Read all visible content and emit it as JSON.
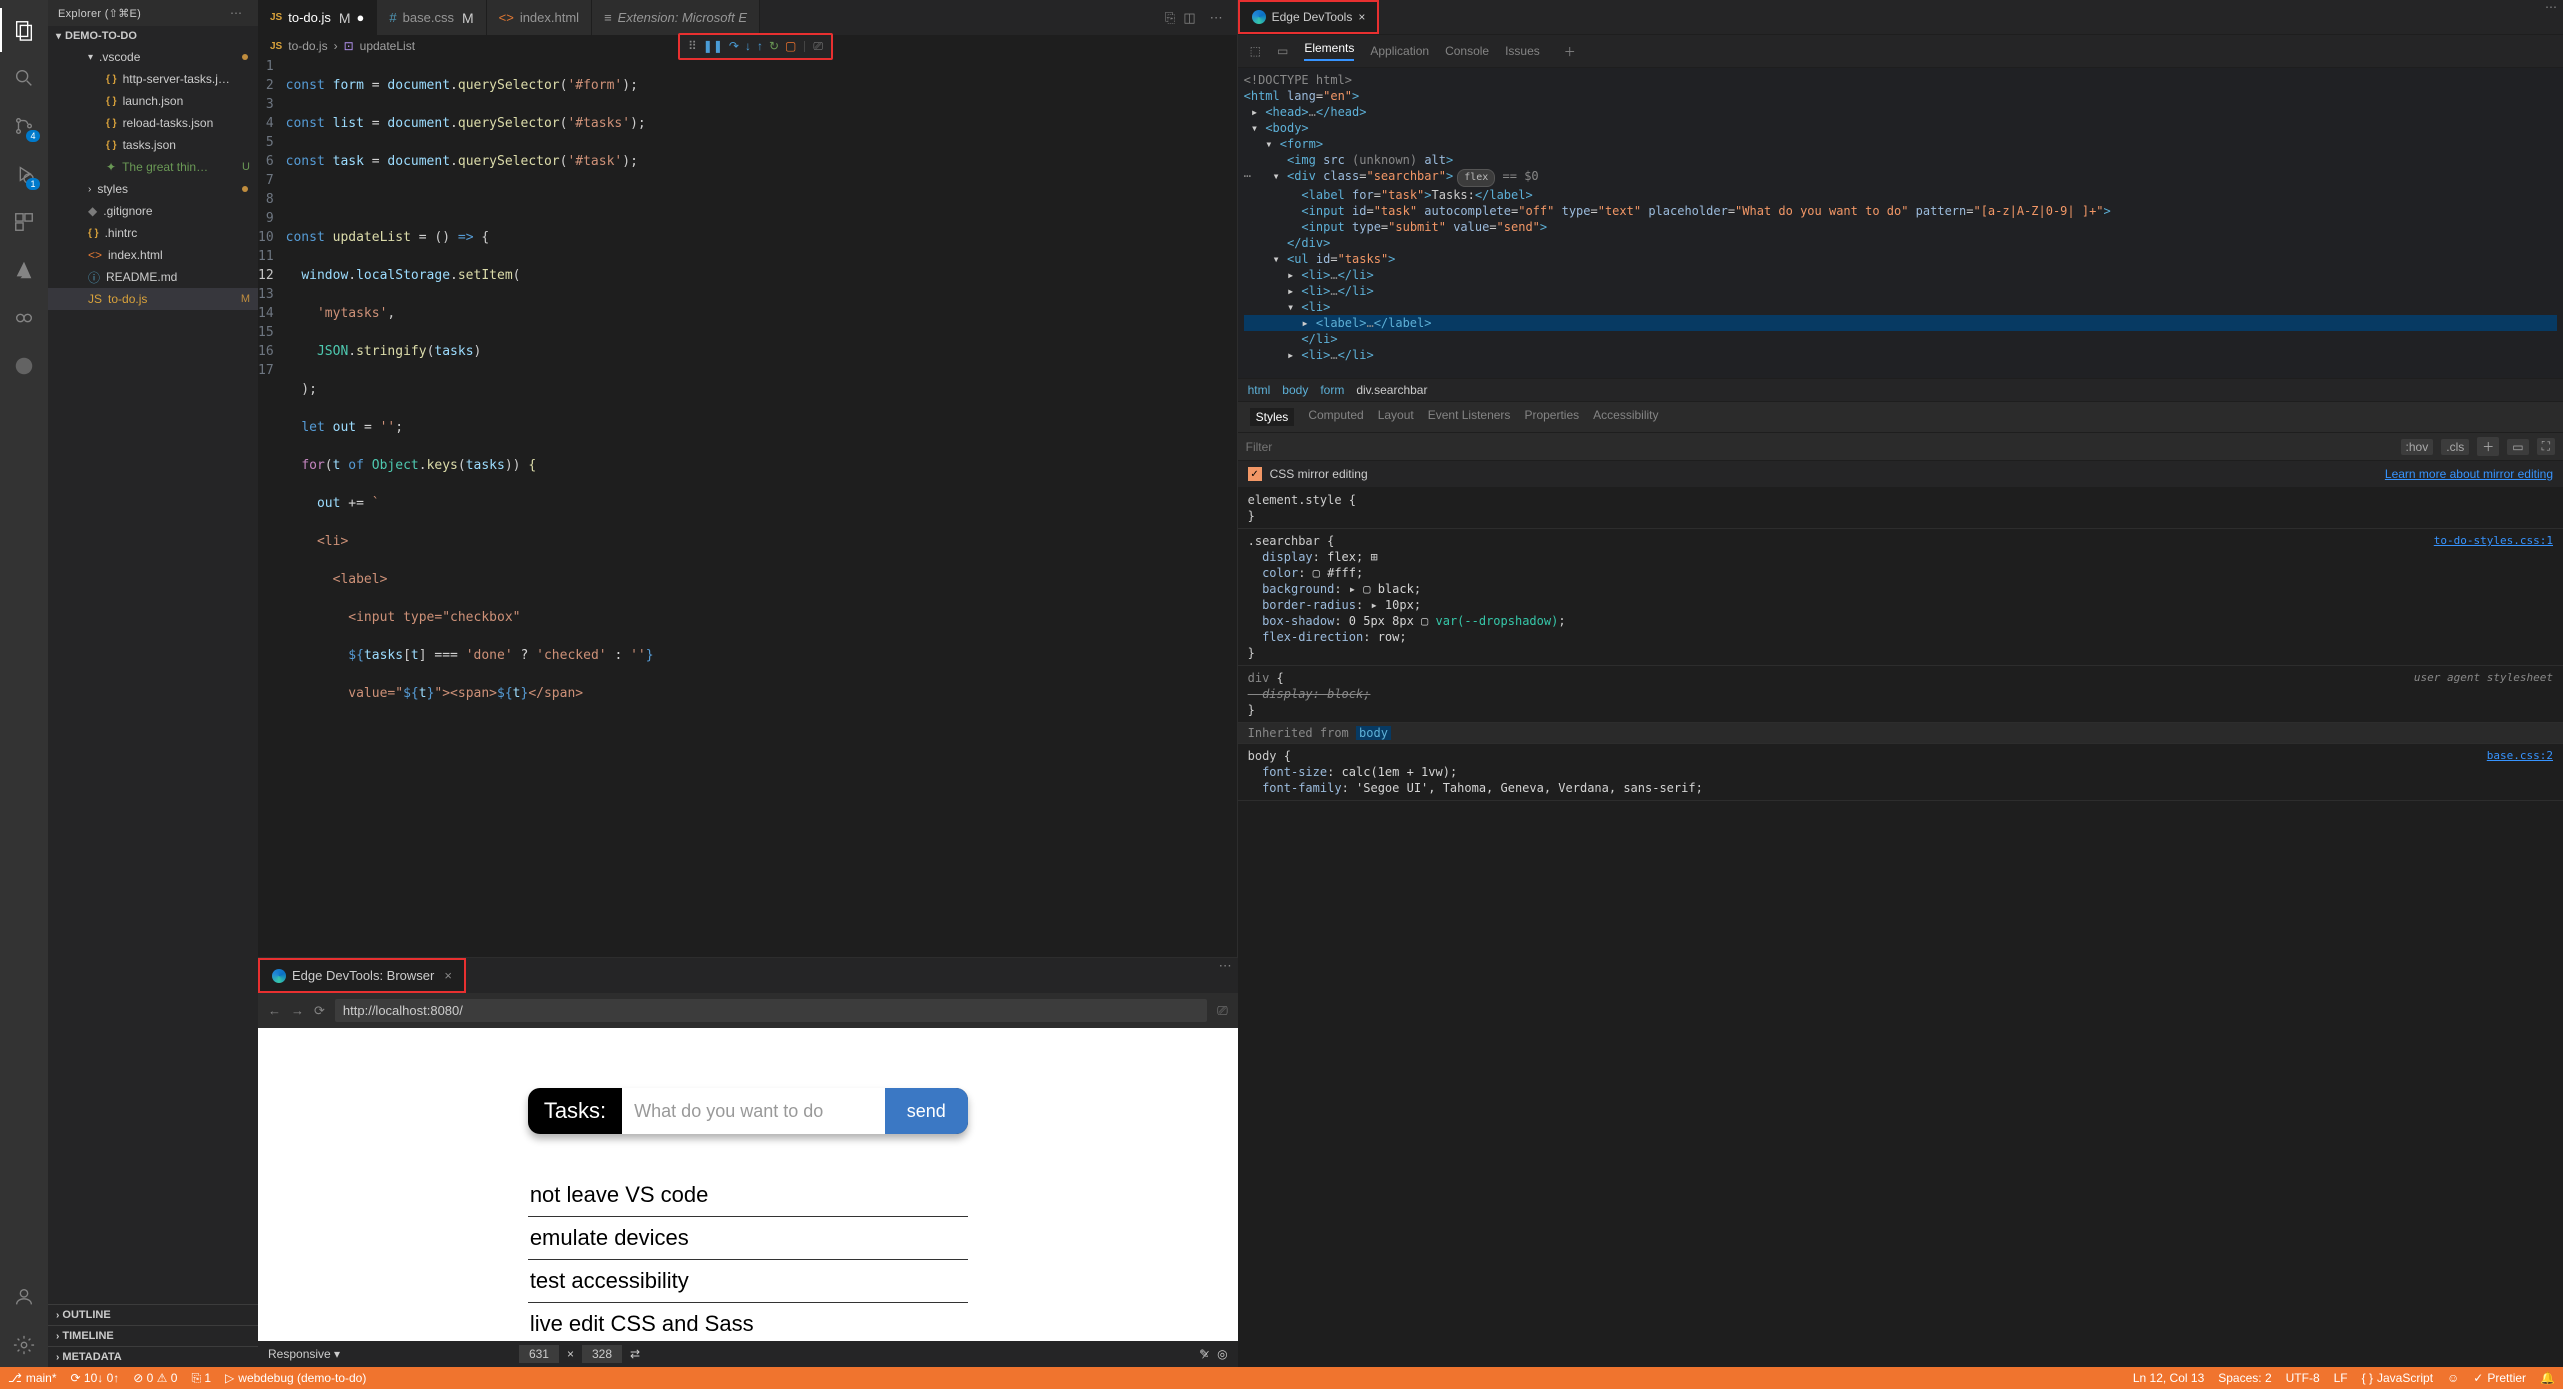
{
  "activity": {
    "scm_badge": "4",
    "debug_badge": "1"
  },
  "sidebar": {
    "title": "Explorer (⇧⌘E)",
    "root": "DEMO-TO-DO",
    "vscode_folder": ".vscode",
    "files": {
      "httpServer": "http-server-tasks.j…",
      "launch": "launch.json",
      "reload": "reload-tasks.json",
      "tasks": "tasks.json",
      "greatThing": "The great thin…",
      "styles": "styles",
      "gitignore": ".gitignore",
      "hintrc": ".hintrc",
      "indexHtml": "index.html",
      "readme": "README.md",
      "todoJs": "to-do.js"
    },
    "outline": "OUTLINE",
    "timeline": "TIMELINE",
    "metadata": "METADATA"
  },
  "editorTabs": {
    "todo": "to-do.js",
    "base": "base.css",
    "indexHtml": "index.html",
    "extension": "Extension: Microsoft E"
  },
  "breadcrumb": {
    "file": "to-do.js",
    "fn": "updateList"
  },
  "code": [
    "const form = document.querySelector('#form');",
    "const list = document.querySelector('#tasks');",
    "const task = document.querySelector('#task');",
    "",
    "const updateList = () => {",
    "  window.localStorage.setItem(",
    "    'mytasks',",
    "    JSON.stringify(tasks)",
    "  );",
    "  let out = '';",
    "  for(t of Object.keys(tasks)) {",
    "    out += `",
    "    <li>",
    "      <label>",
    "        <input type=\"checkbox\"",
    "        ${tasks[t] === 'done' ? 'checked' : ''}",
    "        value=\"${t}\"><span>${t}</span>"
  ],
  "browser": {
    "tabTitle": "Edge DevTools: Browser",
    "url": "http://localhost:8080/",
    "tasksLabel": "Tasks:",
    "placeholder": "What do you want to do",
    "sendBtn": "send",
    "items": [
      "not leave VS code",
      "emulate devices",
      "test accessibility",
      "live edit CSS and Sass"
    ],
    "responsive": "Responsive",
    "width": "631",
    "height": "328"
  },
  "devtools": {
    "tabTitle": "Edge DevTools",
    "panels": [
      "Elements",
      "Application",
      "Console",
      "Issues"
    ],
    "crumbs": [
      "html",
      "body",
      "form",
      "div.searchbar"
    ],
    "stylesTabs": [
      "Styles",
      "Computed",
      "Layout",
      "Event Listeners",
      "Properties",
      "Accessibility"
    ],
    "filterPlaceholder": "Filter",
    "hov": ":hov",
    "cls": ".cls",
    "mirror": "CSS mirror editing",
    "mirrorLink": "Learn more about mirror editing",
    "src1": "to-do-styles.css:1",
    "ua": "user agent stylesheet",
    "inheritedFrom": "Inherited from",
    "inheritedEl": "body",
    "src2": "base.css:2",
    "rules": {
      "searchbar": [
        "display: flex;",
        "color: ▢ #fff;",
        "background: ▸ ▢ black;",
        "border-radius: ▸ 10px;",
        "box-shadow: 0 5px 8px ▢ var(--dropshadow);",
        "flex-direction: row;"
      ],
      "bodyRules": [
        "font-size: calc(1em + 1vw);",
        "font-family: 'Segoe UI', Tahoma, Geneva, Verdana, sans-serif;"
      ]
    }
  },
  "status": {
    "branch": "main*",
    "sync": "⟳ 10↓ 0↑",
    "errs": "⊘ 0 ⚠ 0",
    "port": "⎘ 1",
    "debug": "webdebug (demo-to-do)",
    "pos": "Ln 12, Col 13",
    "spaces": "Spaces: 2",
    "enc": "UTF-8",
    "eol": "LF",
    "lang": "JavaScript",
    "prettier": "Prettier"
  }
}
